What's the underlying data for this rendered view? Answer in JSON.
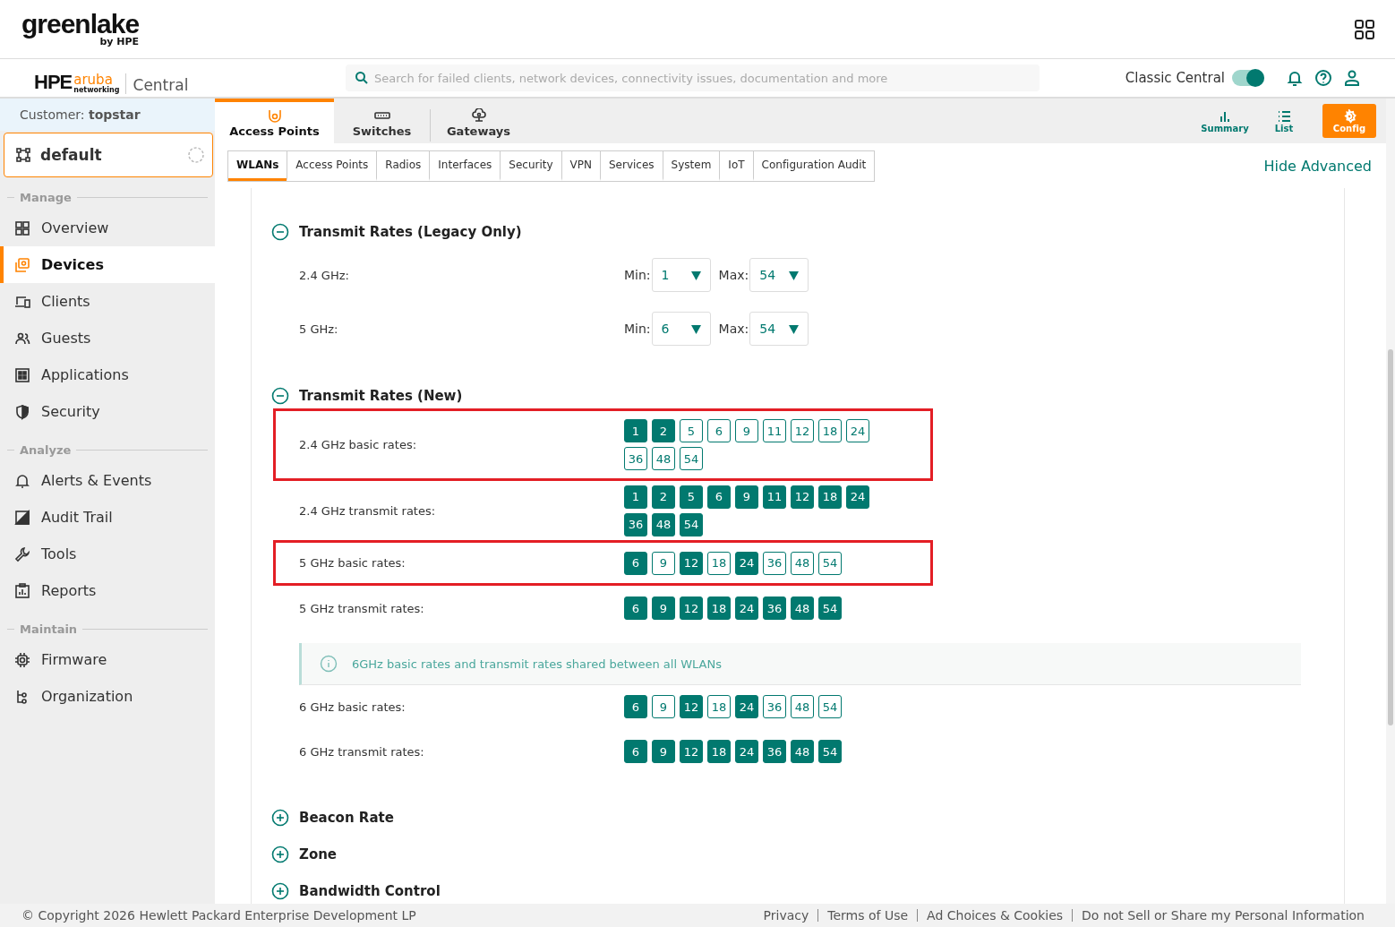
{
  "header": {
    "logo": "greenlake",
    "logo_sub": "by HPE"
  },
  "app_bar": {
    "brand": "HPE",
    "brand_mark": "aruba",
    "brand_sub": "networking",
    "product": "Central",
    "search": {
      "placeholder": "Search for failed clients, network devices, connectivity issues, documentation and more"
    },
    "toggle": {
      "label": "Classic Central",
      "on": true
    }
  },
  "sidebar": {
    "customer_label": "Customer:",
    "customer": "topstar",
    "group": "default",
    "sections": [
      {
        "title": "Manage",
        "items": [
          {
            "label": "Overview",
            "selected": false
          },
          {
            "label": "Devices",
            "selected": true
          },
          {
            "label": "Clients",
            "selected": false
          },
          {
            "label": "Guests",
            "selected": false
          },
          {
            "label": "Applications",
            "selected": false
          },
          {
            "label": "Security",
            "selected": false
          }
        ]
      },
      {
        "title": "Analyze",
        "items": [
          {
            "label": "Alerts & Events",
            "selected": false
          },
          {
            "label": "Audit Trail",
            "selected": false
          },
          {
            "label": "Tools",
            "selected": false
          },
          {
            "label": "Reports",
            "selected": false
          }
        ]
      },
      {
        "title": "Maintain",
        "items": [
          {
            "label": "Firmware",
            "selected": false
          },
          {
            "label": "Organization",
            "selected": false
          }
        ]
      }
    ]
  },
  "device_tabs": [
    {
      "label": "Access Points",
      "selected": true
    },
    {
      "label": "Switches",
      "selected": false
    },
    {
      "label": "Gateways",
      "selected": false
    }
  ],
  "view_buttons": [
    {
      "label": "Summary",
      "selected": false
    },
    {
      "label": "List",
      "selected": false
    },
    {
      "label": "Config",
      "selected": true
    }
  ],
  "subtabs": [
    {
      "label": "WLANs",
      "selected": true
    },
    {
      "label": "Access Points",
      "selected": false
    },
    {
      "label": "Radios",
      "selected": false
    },
    {
      "label": "Interfaces",
      "selected": false
    },
    {
      "label": "Security",
      "selected": false
    },
    {
      "label": "VPN",
      "selected": false
    },
    {
      "label": "Services",
      "selected": false
    },
    {
      "label": "System",
      "selected": false
    },
    {
      "label": "IoT",
      "selected": false
    },
    {
      "label": "Configuration Audit",
      "selected": false
    }
  ],
  "hide_advanced": "Hide Advanced",
  "sections": [
    {
      "title": "Transmit Rates (Legacy Only)",
      "expanded": true,
      "rows": [
        {
          "kind": "minmax",
          "label": "2.4 GHz:",
          "min_label": "Min:",
          "min_value": "1",
          "max_label": "Max:",
          "max_value": "54"
        },
        {
          "kind": "minmax",
          "label": "5 GHz:",
          "min_label": "Min:",
          "min_value": "6",
          "max_label": "Max:",
          "max_value": "54"
        }
      ]
    },
    {
      "title": "Transmit Rates (New)",
      "expanded": true,
      "rows": [
        {
          "kind": "rates",
          "label": "2.4 GHz basic rates:",
          "highlighted": true,
          "rates": [
            {
              "label": "1",
              "selected": true
            },
            {
              "label": "2",
              "selected": true
            },
            {
              "label": "5",
              "selected": false
            },
            {
              "label": "6",
              "selected": false
            },
            {
              "label": "9",
              "selected": false
            },
            {
              "label": "11",
              "selected": false
            },
            {
              "label": "12",
              "selected": false
            },
            {
              "label": "18",
              "selected": false
            },
            {
              "label": "24",
              "selected": false
            },
            {
              "label": "36",
              "selected": false
            },
            {
              "label": "48",
              "selected": false
            },
            {
              "label": "54",
              "selected": false
            }
          ]
        },
        {
          "kind": "rates",
          "label": "2.4 GHz transmit rates:",
          "highlighted": false,
          "rates": [
            {
              "label": "1",
              "selected": true
            },
            {
              "label": "2",
              "selected": true
            },
            {
              "label": "5",
              "selected": true
            },
            {
              "label": "6",
              "selected": true
            },
            {
              "label": "9",
              "selected": true
            },
            {
              "label": "11",
              "selected": true
            },
            {
              "label": "12",
              "selected": true
            },
            {
              "label": "18",
              "selected": true
            },
            {
              "label": "24",
              "selected": true
            },
            {
              "label": "36",
              "selected": true
            },
            {
              "label": "48",
              "selected": true
            },
            {
              "label": "54",
              "selected": true
            }
          ]
        },
        {
          "kind": "rates",
          "label": "5 GHz basic rates:",
          "highlighted": true,
          "rates": [
            {
              "label": "6",
              "selected": true
            },
            {
              "label": "9",
              "selected": false
            },
            {
              "label": "12",
              "selected": true
            },
            {
              "label": "18",
              "selected": false
            },
            {
              "label": "24",
              "selected": true
            },
            {
              "label": "36",
              "selected": false
            },
            {
              "label": "48",
              "selected": false
            },
            {
              "label": "54",
              "selected": false
            }
          ]
        },
        {
          "kind": "rates",
          "label": "5 GHz transmit rates:",
          "highlighted": false,
          "rates": [
            {
              "label": "6",
              "selected": true
            },
            {
              "label": "9",
              "selected": true
            },
            {
              "label": "12",
              "selected": true
            },
            {
              "label": "18",
              "selected": true
            },
            {
              "label": "24",
              "selected": true
            },
            {
              "label": "36",
              "selected": true
            },
            {
              "label": "48",
              "selected": true
            },
            {
              "label": "54",
              "selected": true
            }
          ]
        },
        {
          "kind": "note",
          "text": "6GHz basic rates and transmit rates shared between all WLANs"
        },
        {
          "kind": "rates",
          "label": "6 GHz basic rates:",
          "highlighted": false,
          "rates": [
            {
              "label": "6",
              "selected": true
            },
            {
              "label": "9",
              "selected": false
            },
            {
              "label": "12",
              "selected": true
            },
            {
              "label": "18",
              "selected": false
            },
            {
              "label": "24",
              "selected": true
            },
            {
              "label": "36",
              "selected": false
            },
            {
              "label": "48",
              "selected": false
            },
            {
              "label": "54",
              "selected": false
            }
          ]
        },
        {
          "kind": "rates",
          "label": "6 GHz transmit rates:",
          "highlighted": false,
          "rates": [
            {
              "label": "6",
              "selected": true
            },
            {
              "label": "9",
              "selected": true
            },
            {
              "label": "12",
              "selected": true
            },
            {
              "label": "18",
              "selected": true
            },
            {
              "label": "24",
              "selected": true
            },
            {
              "label": "36",
              "selected": true
            },
            {
              "label": "48",
              "selected": true
            },
            {
              "label": "54",
              "selected": true
            }
          ]
        }
      ]
    },
    {
      "title": "Beacon Rate",
      "expanded": false
    },
    {
      "title": "Zone",
      "expanded": false
    },
    {
      "title": "Bandwidth Control",
      "expanded": false
    }
  ],
  "footer": {
    "copyright": "© Copyright 2026 Hewlett Packard Enterprise Development LP",
    "links": [
      "Privacy",
      "Terms of Use",
      "Ad Choices & Cookies",
      "Do not Sell or Share my Personal Information"
    ]
  }
}
